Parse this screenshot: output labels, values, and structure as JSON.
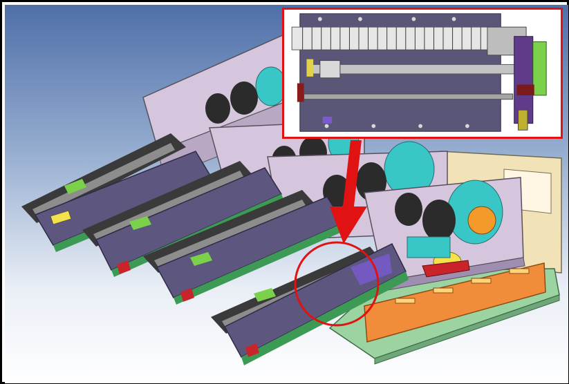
{
  "image": {
    "kind": "cad-3d-assembly-render",
    "colors": {
      "background_top": "#4f6fa8",
      "background_bottom": "#ffffff",
      "frame_border": "#000000",
      "inset_border": "#e01212",
      "callout": "#e01212",
      "housing": "#d6c6dd",
      "base_plate": "#9bd3a1",
      "orange_rail": "#f08c3a",
      "teal_roll": "#38c6c6",
      "dark_roll": "#2b2b2b",
      "yellow_part": "#f3e24c",
      "green_marker": "#7bd24a",
      "bed_purple": "#5d5780"
    },
    "icons": {
      "callout_arrow": "down-arrow-icon",
      "focus_marker": "circle-highlight-icon"
    }
  }
}
